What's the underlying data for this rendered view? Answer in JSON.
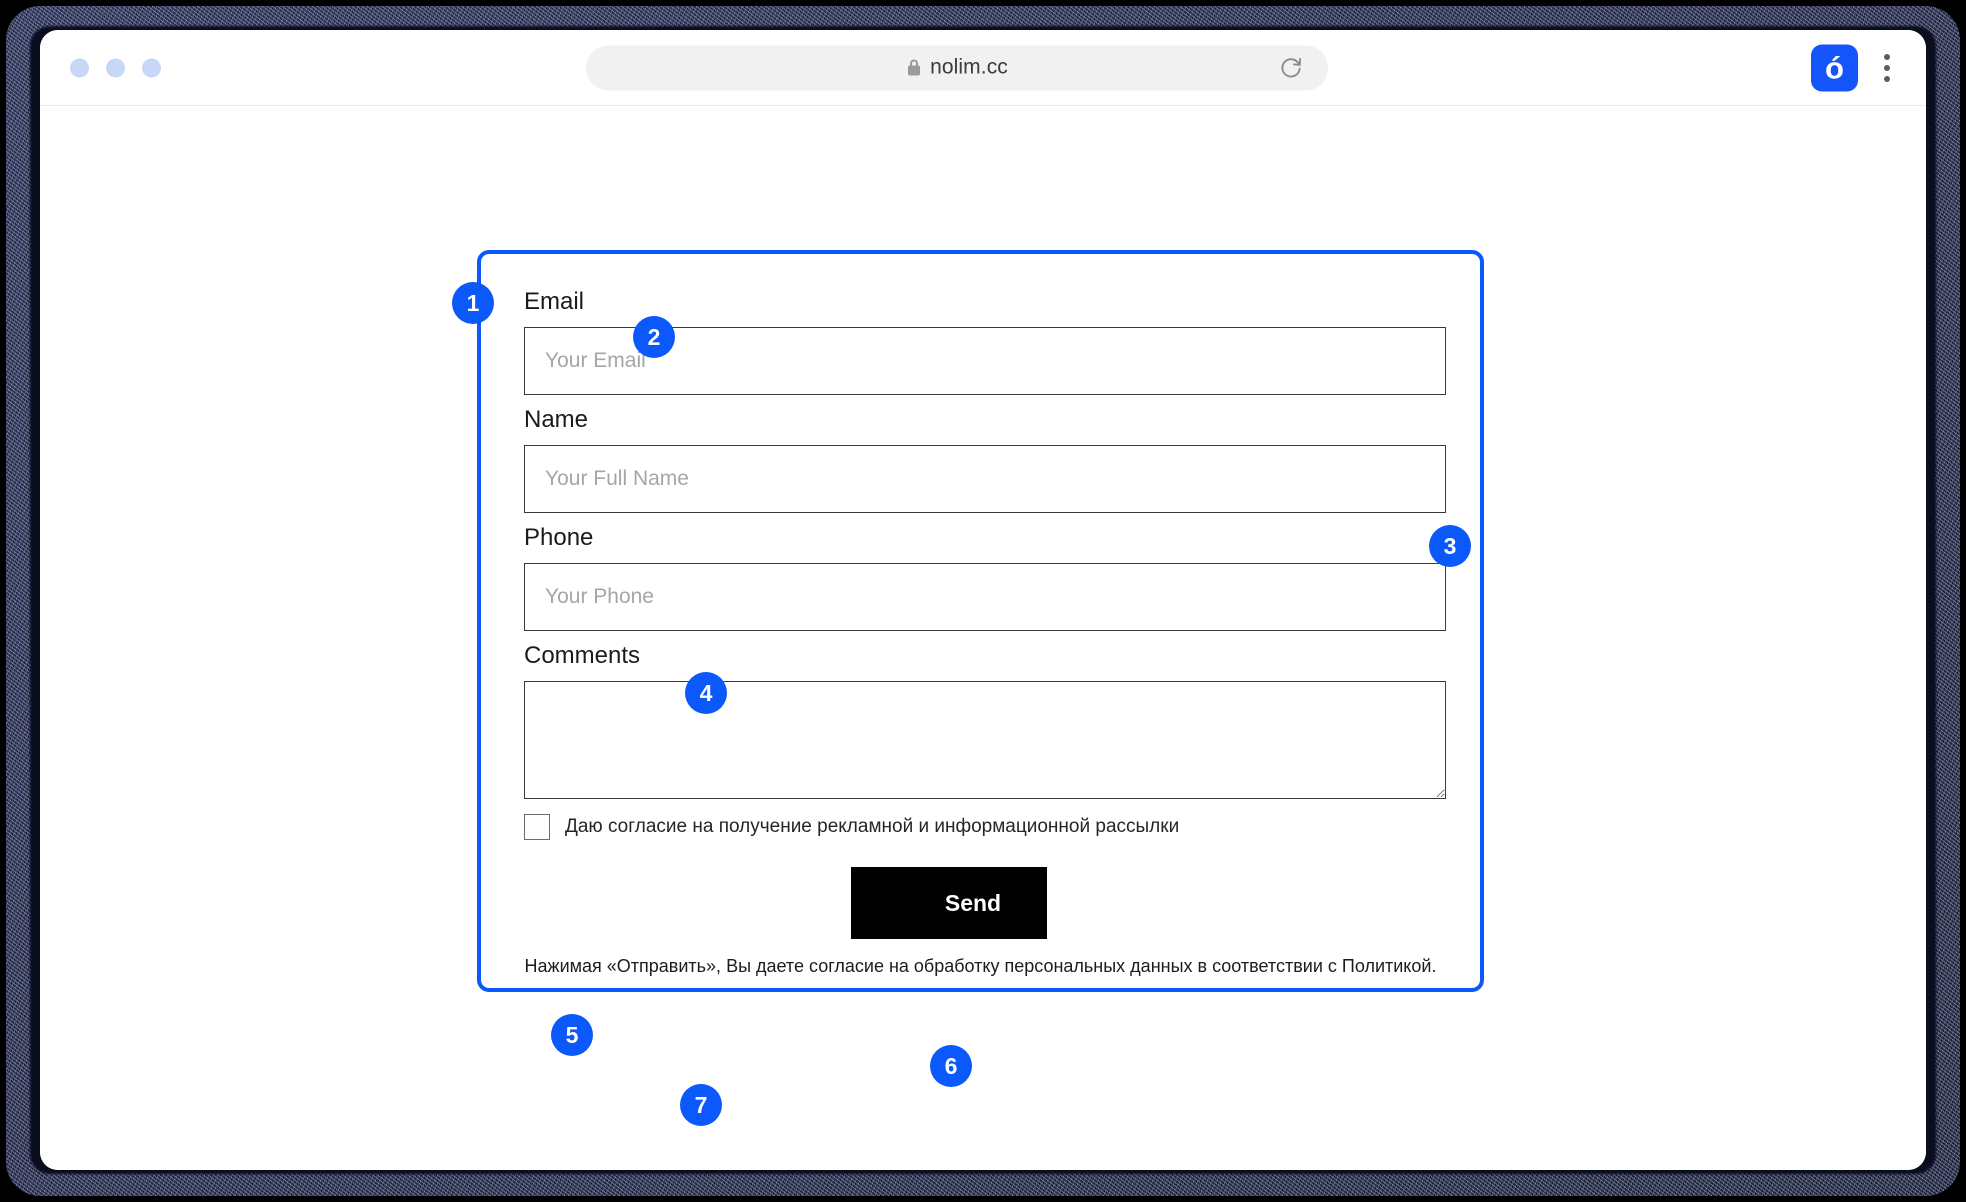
{
  "browser": {
    "url": "nolim.cc",
    "lock_icon": "lock-icon",
    "reload_icon": "reload-icon",
    "brand_icon_letter": "ó",
    "menu_icon": "kebab-menu-icon",
    "accent_color": "#0b58fb",
    "traffic_light_color": "#c6d7f7"
  },
  "form": {
    "border_color": "#0b58fb",
    "fields": [
      {
        "label": "Email",
        "placeholder": "Your Email",
        "value": ""
      },
      {
        "label": "Name",
        "placeholder": "Your Full Name",
        "value": ""
      },
      {
        "label": "Phone",
        "placeholder": "Your Phone",
        "value": ""
      },
      {
        "label": "Comments",
        "placeholder": "",
        "value": ""
      }
    ],
    "consent": {
      "checked": false,
      "text": "Даю согласие на получение рекламной и информационной рассылки"
    },
    "submit": {
      "label": "Send",
      "background": "#000000",
      "text_color": "#ffffff"
    },
    "legal": "Нажимая «Отправить», Вы даете согласие на обработку персональных данных в соответствии с Политикой."
  },
  "annotations": [
    {
      "number": "1"
    },
    {
      "number": "2"
    },
    {
      "number": "3"
    },
    {
      "number": "4"
    },
    {
      "number": "5"
    },
    {
      "number": "6"
    },
    {
      "number": "7"
    }
  ]
}
